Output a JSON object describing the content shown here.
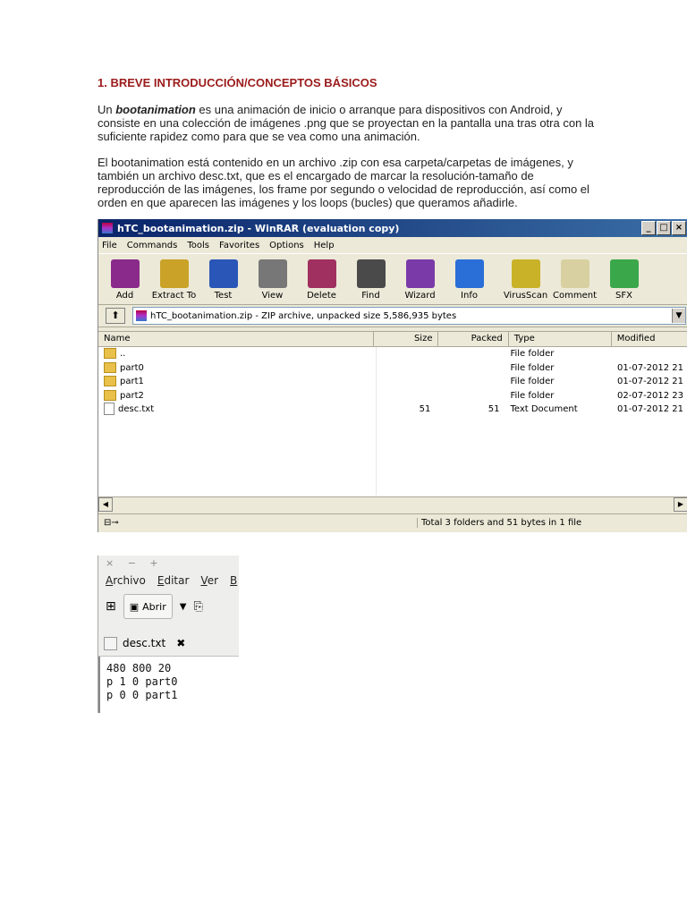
{
  "doc": {
    "heading": "1. BREVE INTRODUCCIÓN/CONCEPTOS BÁSICOS",
    "p1_prefix": "Un ",
    "p1_term": "bootanimation",
    "p1_rest": " es una animación de inicio o arranque para dispositivos con Android, y consiste en una colección de imágenes .png que se proyectan en la pantalla una tras otra con la suficiente rapidez como para que se vea como una animación.",
    "p2": "El bootanimation está contenido en un archivo .zip con esa carpeta/carpetas de imágenes, y también un archivo desc.txt, que es el encargado de marcar la resolución-tamaño de reproducción de las imágenes, los frame por segundo o velocidad de reproducción, así como el orden en que aparecen las imágenes y los loops (bucles) que queramos añadirle."
  },
  "winrar": {
    "title": "hTC_bootanimation.zip - WinRAR (evaluation copy)",
    "controls": [
      "_",
      "□",
      "×"
    ],
    "menu": [
      "File",
      "Commands",
      "Tools",
      "Favorites",
      "Options",
      "Help"
    ],
    "tools": [
      {
        "label": "Add",
        "icon": "add-icon",
        "color": "#8a2a8a"
      },
      {
        "label": "Extract To",
        "icon": "extract-icon",
        "color": "#c9a227"
      },
      {
        "label": "Test",
        "icon": "test-icon",
        "color": "#2a56b8"
      },
      {
        "label": "View",
        "icon": "view-icon",
        "color": "#777777"
      },
      {
        "label": "Delete",
        "icon": "delete-icon",
        "color": "#a03060"
      },
      {
        "label": "Find",
        "icon": "find-icon",
        "color": "#4a4a4a"
      },
      {
        "label": "Wizard",
        "icon": "wizard-icon",
        "color": "#7a3aa8"
      },
      {
        "label": "Info",
        "icon": "info-icon",
        "color": "#2a6ed8"
      },
      {
        "label": "VirusScan",
        "icon": "virusscan-icon",
        "color": "#c9b227"
      },
      {
        "label": "Comment",
        "icon": "comment-icon",
        "color": "#d8d0a0"
      },
      {
        "label": "SFX",
        "icon": "sfx-icon",
        "color": "#3aa84a"
      }
    ],
    "address": "hTC_bootanimation.zip - ZIP archive, unpacked size 5,586,935 bytes",
    "columns": [
      "Name",
      "Size",
      "Packed",
      "Type",
      "Modified"
    ],
    "rows": [
      {
        "name": "..",
        "size": "",
        "packed": "",
        "type": "File folder",
        "modified": "",
        "kind": "folder"
      },
      {
        "name": "part0",
        "size": "",
        "packed": "",
        "type": "File folder",
        "modified": "01-07-2012 21",
        "kind": "folder"
      },
      {
        "name": "part1",
        "size": "",
        "packed": "",
        "type": "File folder",
        "modified": "01-07-2012 21",
        "kind": "folder"
      },
      {
        "name": "part2",
        "size": "",
        "packed": "",
        "type": "File folder",
        "modified": "02-07-2012 23",
        "kind": "folder"
      },
      {
        "name": "desc.txt",
        "size": "51",
        "packed": "51",
        "type": "Text Document",
        "modified": "01-07-2012 21",
        "kind": "file"
      }
    ],
    "status": "Total 3 folders and 51 bytes in 1 file"
  },
  "gedit": {
    "title_controls": "× − +",
    "menu": [
      "Archivo",
      "Editar",
      "Ver",
      "B"
    ],
    "open_label": "Abrir",
    "tab_label": "desc.txt",
    "lines": [
      "480 800 20",
      "p 1 0 part0",
      "p 0 0 part1"
    ]
  }
}
